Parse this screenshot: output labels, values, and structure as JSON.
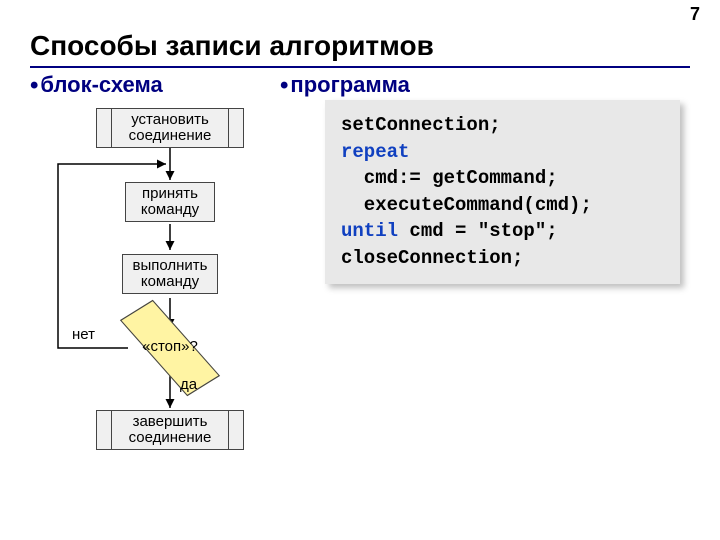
{
  "page_number": "7",
  "title": "Способы записи алгоритмов",
  "left_heading": "блок-схема",
  "right_heading": "программа",
  "flowchart": {
    "n1": "установить\nсоединение",
    "n2": "принять\nкоманду",
    "n3": "выполнить\nкоманду",
    "decision": "«стоп»?",
    "no": "нет",
    "yes": "да",
    "n4": "завершить\nсоединение"
  },
  "code": {
    "l1": "setConnection;",
    "kw_repeat": "repeat",
    "l3": "  cmd:= getCommand;",
    "l4": "  executeCommand(cmd);",
    "kw_until": "until",
    "l5_rest": " cmd = \"stop\";",
    "l6": "closeConnection;"
  }
}
